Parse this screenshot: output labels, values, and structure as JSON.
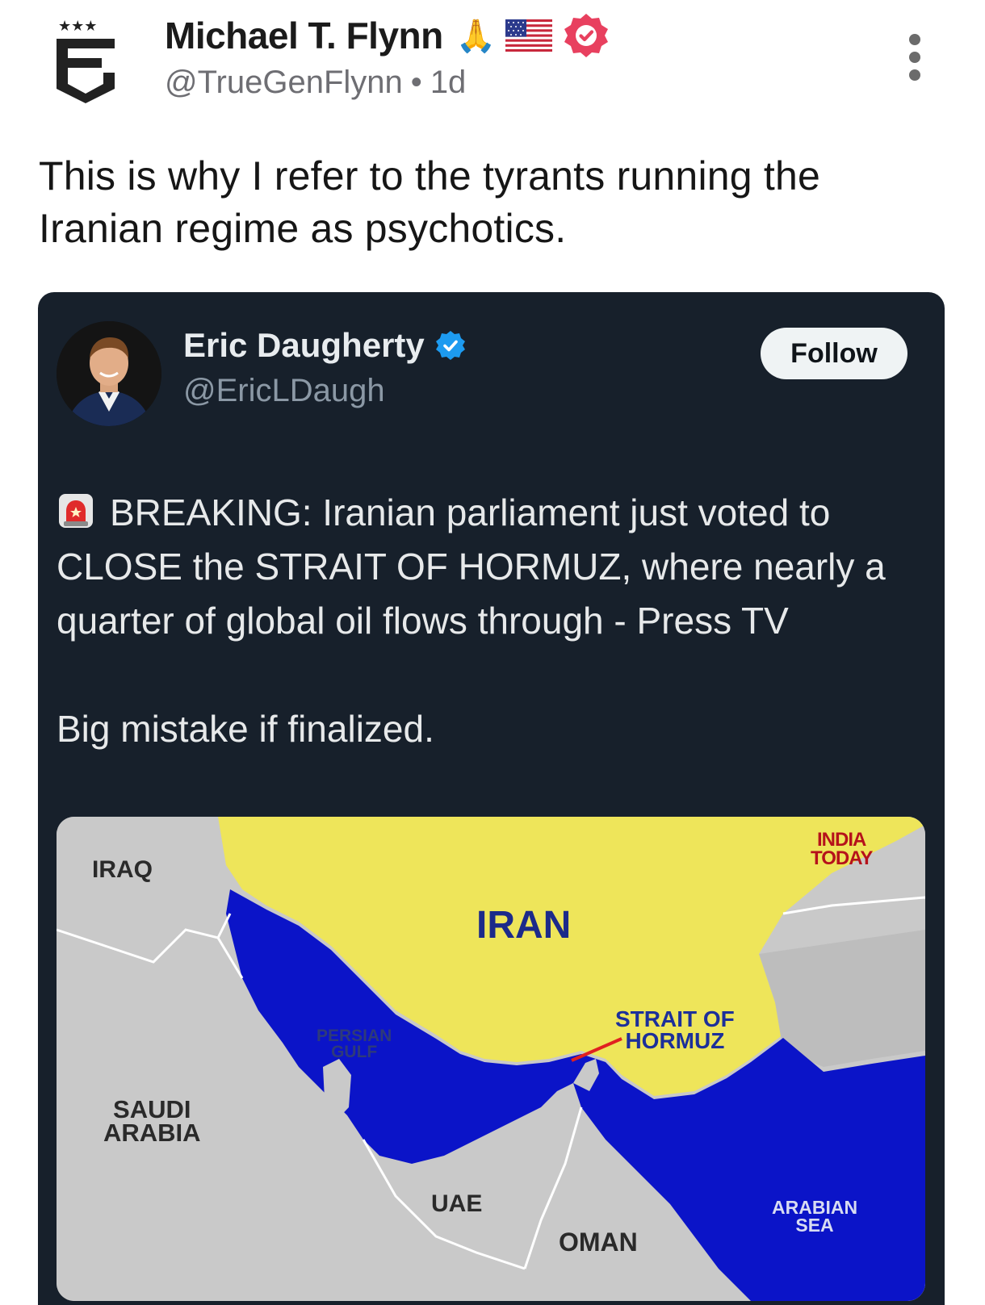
{
  "post": {
    "author_name": "Michael T. Flynn",
    "author_emoji": "🙏",
    "author_handle": "@TrueGenFlynn",
    "separator": "•",
    "time_ago": "1d",
    "text": "This is why I refer to the tyrants running the Iranian regime as psychotics.",
    "badge_color": "#e8405f"
  },
  "quoted_post": {
    "author_name": "Eric Daugherty",
    "author_handle": "@EricLDaugh",
    "follow_label": "Follow",
    "text_line1": "BREAKING: Iranian parliament just voted to CLOSE the STRAIT OF HORMUZ, where nearly a quarter of global oil flows through - Press TV",
    "text_line2": "Big mistake if finalized.",
    "card_background": "#17202b",
    "verified_color": "#1d9bf0"
  },
  "map": {
    "labels": {
      "iraq": "IRAQ",
      "iran": "IRAN",
      "persian_gulf_1": "PERSIAN",
      "persian_gulf_2": "GULF",
      "strait_1": "STRAIT OF",
      "strait_2": "HORMUZ",
      "saudi_1": "SAUDI",
      "saudi_2": "ARABIA",
      "uae": "UAE",
      "oman": "OMAN",
      "arabian_1": "ARABIAN",
      "arabian_2": "SEA",
      "brand_1": "INDIA",
      "brand_2": "TODAY"
    },
    "colors": {
      "land": "#c9c9c9",
      "iran": "#eee55a",
      "water": "#0b14c8"
    }
  }
}
